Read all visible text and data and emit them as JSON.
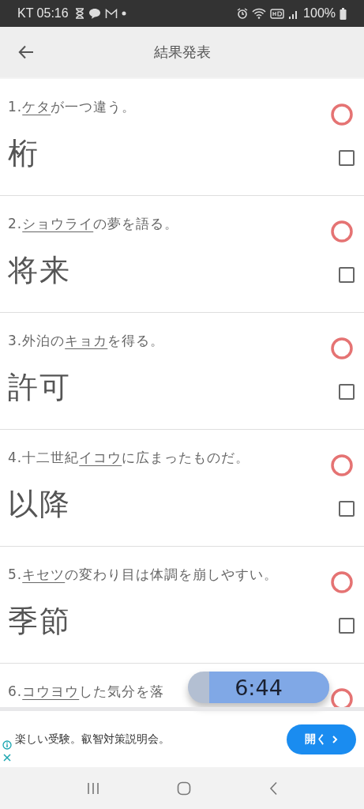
{
  "status_bar": {
    "carrier_time": "KT 05:16",
    "battery": "100%"
  },
  "header": {
    "title": "結果発表"
  },
  "questions": [
    {
      "number": "1.",
      "underlined": "ケタ",
      "after": "が一つ違う。",
      "answer": "桁",
      "correct": true,
      "checked": false
    },
    {
      "number": "2.",
      "underlined": "ショウライ",
      "after": "の夢を語る。",
      "answer": "将来",
      "correct": true,
      "checked": false
    },
    {
      "number": "3.",
      "before": "外泊の",
      "underlined": "キョカ",
      "after": "を得る。",
      "answer": "許可",
      "correct": true,
      "checked": false
    },
    {
      "number": "4.",
      "before": "十二世紀",
      "underlined": "イコウ",
      "after": "に広まったものだ。",
      "answer": "以降",
      "correct": true,
      "checked": false
    },
    {
      "number": "5.",
      "underlined": "キセツ",
      "after": "の変わり目は体調を崩しやすい。",
      "answer": "季節",
      "correct": true,
      "checked": false
    },
    {
      "number": "6.",
      "underlined": "コウヨウ",
      "after": "した気分を落",
      "correct": true
    }
  ],
  "timer": {
    "time": "6:44",
    "level": 0.85
  },
  "ad": {
    "text": "楽しい受験。叡智対策説明会。",
    "button": "開く"
  }
}
